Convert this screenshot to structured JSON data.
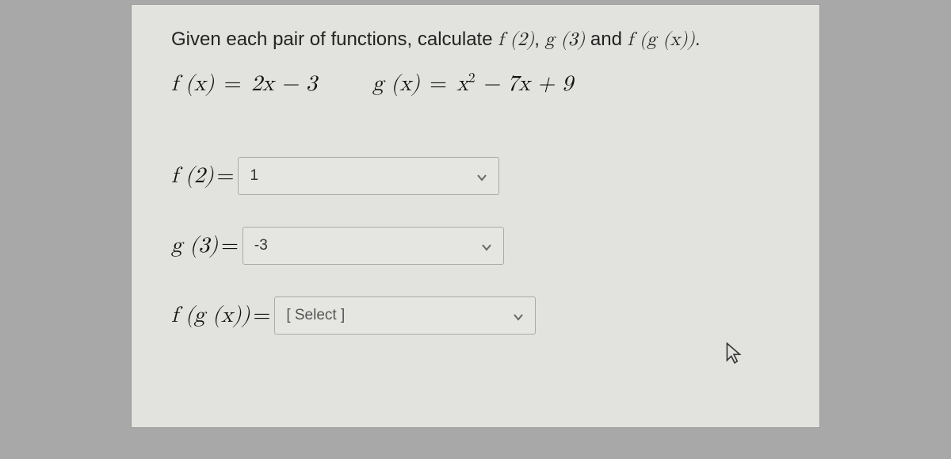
{
  "instruction": {
    "prefix": "Given each pair of functions, calculate ",
    "part1": "f (2)",
    "comma1": ", ",
    "part2": "g (3)",
    "and": " and ",
    "part3": "f (g (x))",
    "suffix": "."
  },
  "fdef": {
    "lhs": "f (x)",
    "eq": " = ",
    "rhs": "2x − 3"
  },
  "gdef": {
    "lhs": "g (x)",
    "eq": " = ",
    "rhs_a": "x",
    "rhs_sup": "2",
    "rhs_b": " − 7x + 9"
  },
  "questions": {
    "q1": {
      "label": "f (2)",
      "eq": "=",
      "value": "1"
    },
    "q2": {
      "label": "g (3)",
      "eq": "=",
      "value": "-3"
    },
    "q3": {
      "label": "f (g (x))",
      "eq": "=",
      "value": "[ Select ]"
    }
  }
}
